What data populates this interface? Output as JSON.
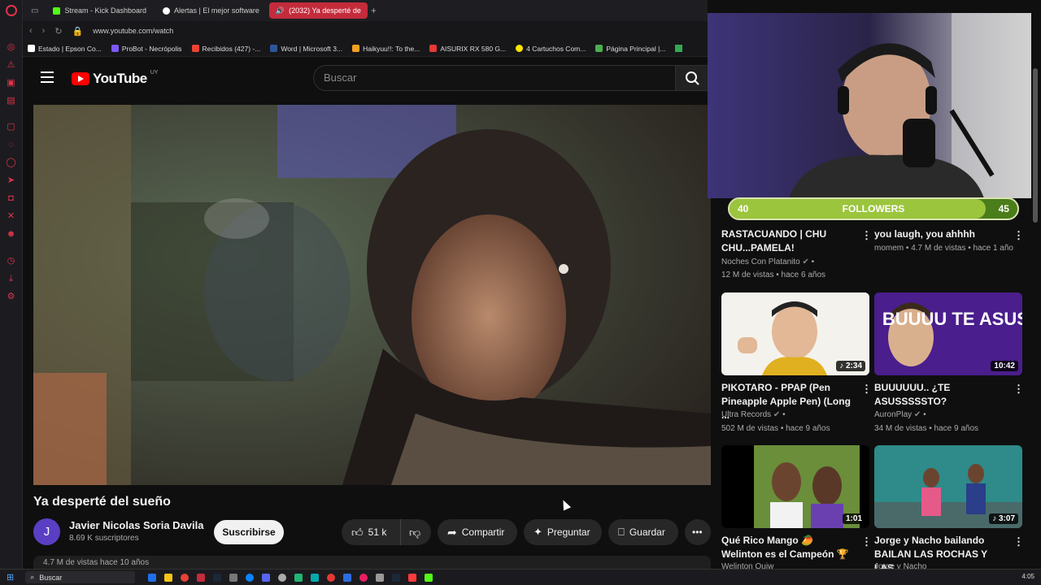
{
  "browser": {
    "tabs": [
      {
        "label": "Stream - Kick Dashboard",
        "color": "#53fc18"
      },
      {
        "label": "Alertas | El mejor software",
        "color": "#ffffff"
      },
      {
        "label": "(2032) Ya desperté de",
        "color": "#ff0000"
      }
    ],
    "url": "www.youtube.com/watch",
    "bookmarks": [
      {
        "label": "Estado | Epson Co...",
        "color": "#ffffff"
      },
      {
        "label": "ProBot - Necrópolis",
        "color": "#7a5af8"
      },
      {
        "label": "Recibidos (427) -...",
        "color": "#ea4335"
      },
      {
        "label": "Word | Microsoft 3...",
        "color": "#2b579a"
      },
      {
        "label": "Haikyuu!!: To the...",
        "color": "#f4a020"
      },
      {
        "label": "AISURIX RX 580 G...",
        "color": "#e53935"
      },
      {
        "label": "4 Cartuchos Com...",
        "color": "#ffe600"
      },
      {
        "label": "Página Principal |...",
        "color": "#4caf50"
      }
    ]
  },
  "youtube": {
    "logo_text": "YouTube",
    "country": "UY",
    "search_placeholder": "Buscar"
  },
  "video": {
    "title": "Ya desperté del sueño",
    "channel": "Javier Nicolas Soria Davila",
    "channel_initial": "J",
    "subscribers": "8.69 K suscriptores",
    "subscribe_label": "Suscribirse",
    "likes": "51 k",
    "share_label": "Compartir",
    "ask_label": "Preguntar",
    "save_label": "Guardar",
    "views": "4.7 M de vistas  hace 10 años"
  },
  "overlay": {
    "followers_current": "40",
    "followers_label": "FOLLOWERS",
    "followers_goal": "45",
    "progress": 0.89
  },
  "recommendations": [
    {
      "title": "RASTACUANDO | CHU CHU...PAMELA!",
      "channel": "Noches Con Platanito",
      "meta": "12 M de vistas • hace 6 años"
    },
    {
      "title": "you laugh, you ahhhh",
      "channel": "momem",
      "meta": "4.7 M de vistas • hace 1 año"
    },
    {
      "title": "PIKOTARO - PPAP (Pen Pineapple Apple Pen) (Long ...",
      "channel": "Ultra Records",
      "meta": "502 M de vistas • hace 9 años",
      "duration": "2:34"
    },
    {
      "title": "BUUUUUU.. ¿TE ASUSSSSSTO?",
      "channel": "AuronPlay",
      "meta": "34 M de vistas • hace 9 años",
      "duration": "10:42",
      "thumb_text": "BUUUU TE ASUSTO"
    },
    {
      "title": "Qué Rico Mango 🥭 Welinton es el Campeón 🏆",
      "channel": "Welinton Quiw",
      "meta": "",
      "duration": "1:01"
    },
    {
      "title": "Jorge y Nacho bailando BAILAN LAS ROCHAS Y LAS ...",
      "channel": "Jorge y Nacho",
      "meta": "",
      "duration": "3:07"
    }
  ],
  "taskbar": {
    "search": "Buscar",
    "time": "4:05"
  }
}
